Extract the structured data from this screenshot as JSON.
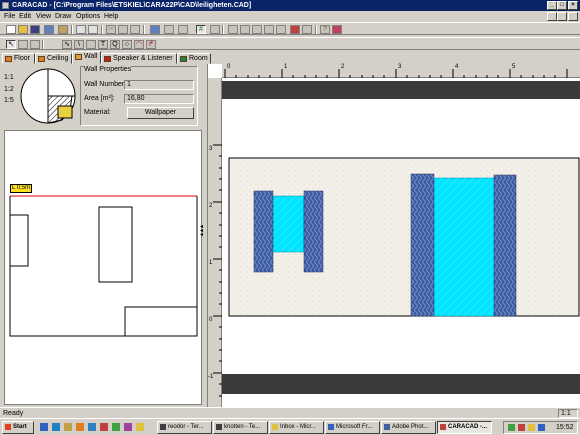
{
  "window": {
    "title": "CARACAD - [C:\\Program Files\\ETSKIEL\\CARA22P\\CAD\\leiligheten.CAD]",
    "minimize": "_",
    "maximize": "□",
    "close": "×"
  },
  "menu": [
    "File",
    "Edit",
    "View",
    "Draw",
    "Options",
    "Help"
  ],
  "tabs": [
    {
      "label": "Floor",
      "active": false
    },
    {
      "label": "Ceiling",
      "active": false
    },
    {
      "label": "Wall",
      "active": true
    },
    {
      "label": "Speaker & Listener",
      "active": false
    },
    {
      "label": "Room",
      "active": false
    }
  ],
  "scale_buttons": [
    "1:1",
    "1:2",
    "1:5"
  ],
  "wall_properties": {
    "group_title": "Wall Properties",
    "wall_number_label": "Wall Number:",
    "wall_number_value": "1",
    "area_label": "Area [m²]:",
    "area_value": "16,80",
    "material_label": "Material:",
    "material_button": "Wallpaper"
  },
  "plan": {
    "length_tag": "L 0,5m"
  },
  "ruler": {
    "x_ticks": [
      "0",
      "1",
      "2",
      "3",
      "4",
      "5"
    ],
    "y_ticks": [
      "3",
      "2",
      "1",
      "0",
      "-1"
    ]
  },
  "status": {
    "text": "Ready",
    "scale": "1:1"
  },
  "taskbar": {
    "start": "Start",
    "tasks": [
      {
        "label": "reodor - Ter...",
        "active": false
      },
      {
        "label": "knotten - Te...",
        "active": false
      },
      {
        "label": "Inbox - Micr...",
        "active": false
      },
      {
        "label": "Microsoft Fr...",
        "active": false
      },
      {
        "label": "Adobe Phot...",
        "active": false
      },
      {
        "label": "CARACAD -...",
        "active": true
      }
    ],
    "clock": "15:52"
  },
  "colors": {
    "titlebar": "#0a246a",
    "glass": "#00e4ff",
    "curtain": "#3d5a9c",
    "wall_band": "#3a3a3a",
    "plan_line": "#e00000",
    "tag_bg": "#ffe020"
  }
}
